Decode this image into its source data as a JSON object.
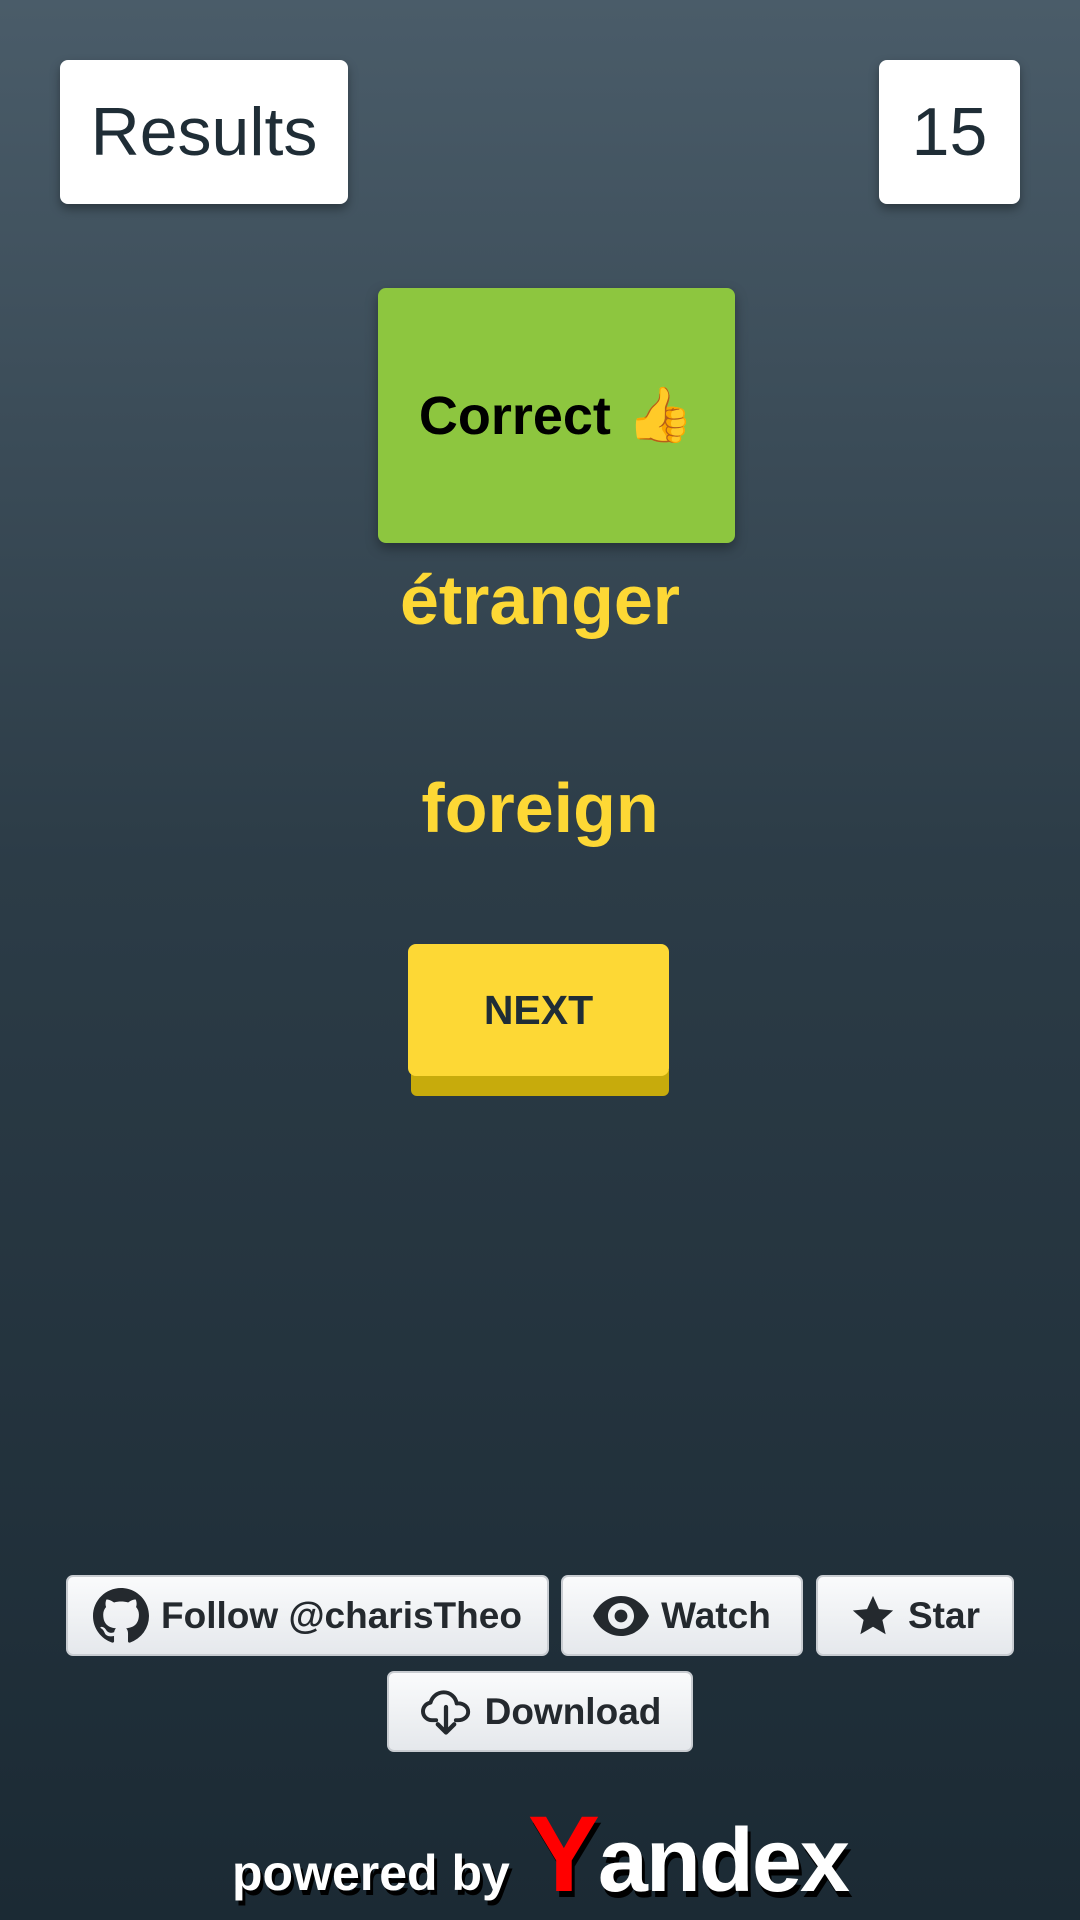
{
  "header": {
    "results_label": "Results",
    "score": "15"
  },
  "feedback": {
    "label": "Correct",
    "emoji": "👍",
    "color": "#8dc63f"
  },
  "quiz": {
    "word": "étranger",
    "answer": "foreign",
    "next_label": "NEXT",
    "accent_color": "#fdd835"
  },
  "github": {
    "follow_label": "Follow @charisTheo",
    "watch_label": "Watch",
    "star_label": "Star",
    "download_label": "Download"
  },
  "footer": {
    "powered_label": "powered by",
    "logo_first_letter": "Y",
    "logo_rest": "andex",
    "logo_accent": "#ff0000"
  }
}
